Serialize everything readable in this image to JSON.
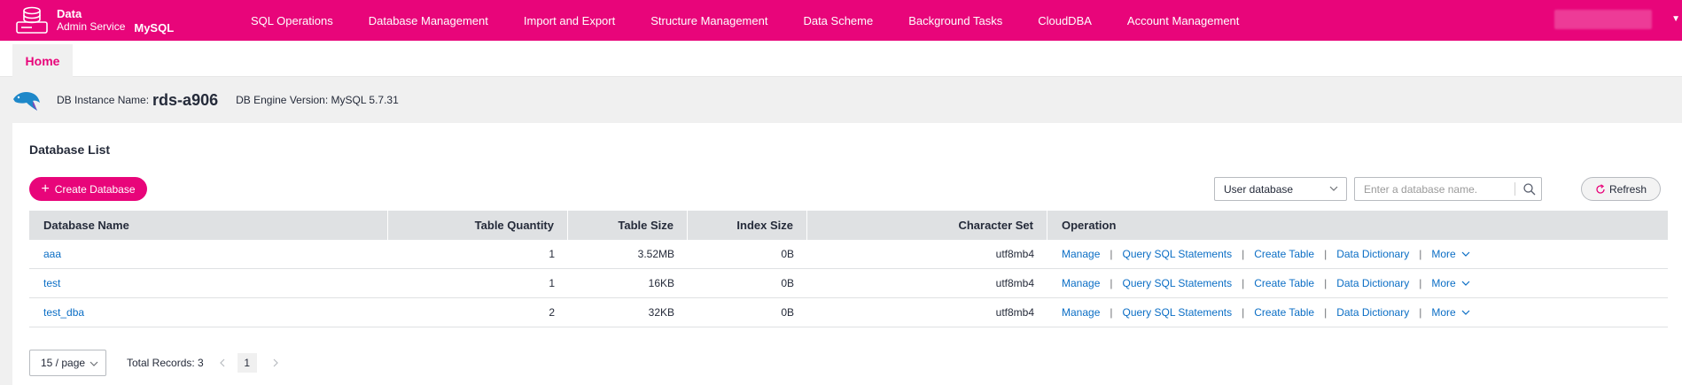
{
  "header": {
    "logo_line1": "Data",
    "logo_line2": "Admin Service",
    "engine": "MySQL",
    "nav": [
      "SQL Operations",
      "Database Management",
      "Import and Export",
      "Structure Management",
      "Data Scheme",
      "Background Tasks",
      "CloudDBA",
      "Account Management"
    ]
  },
  "tabs": {
    "home": "Home"
  },
  "instance": {
    "name_label": "DB Instance Name:",
    "name": "rds-a906",
    "engine_version": "DB Engine Version: MySQL 5.7.31"
  },
  "database_list": {
    "title": "Database List",
    "create_button": "Create Database",
    "filter_select": "User database",
    "search_placeholder": "Enter a database name.",
    "refresh_button": "Refresh",
    "columns": [
      "Database Name",
      "Table Quantity",
      "Table Size",
      "Index Size",
      "Character Set",
      "Operation"
    ],
    "rows": [
      {
        "name": "aaa",
        "table_quantity": "1",
        "table_size": "3.52MB",
        "index_size": "0B",
        "charset": "utf8mb4"
      },
      {
        "name": "test",
        "table_quantity": "1",
        "table_size": "16KB",
        "index_size": "0B",
        "charset": "utf8mb4"
      },
      {
        "name": "test_dba",
        "table_quantity": "2",
        "table_size": "32KB",
        "index_size": "0B",
        "charset": "utf8mb4"
      }
    ],
    "operations": {
      "manage": "Manage",
      "query_sql": "Query SQL Statements",
      "create_table": "Create Table",
      "data_dictionary": "Data Dictionary",
      "more": "More",
      "separator": "|"
    }
  },
  "pagination": {
    "page_size": "15 / page",
    "total": "Total Records: 3",
    "current_page": "1"
  },
  "colors": {
    "brand": "#e8057a",
    "link": "#0b6ec5",
    "table_header": "#dfe1e3"
  }
}
